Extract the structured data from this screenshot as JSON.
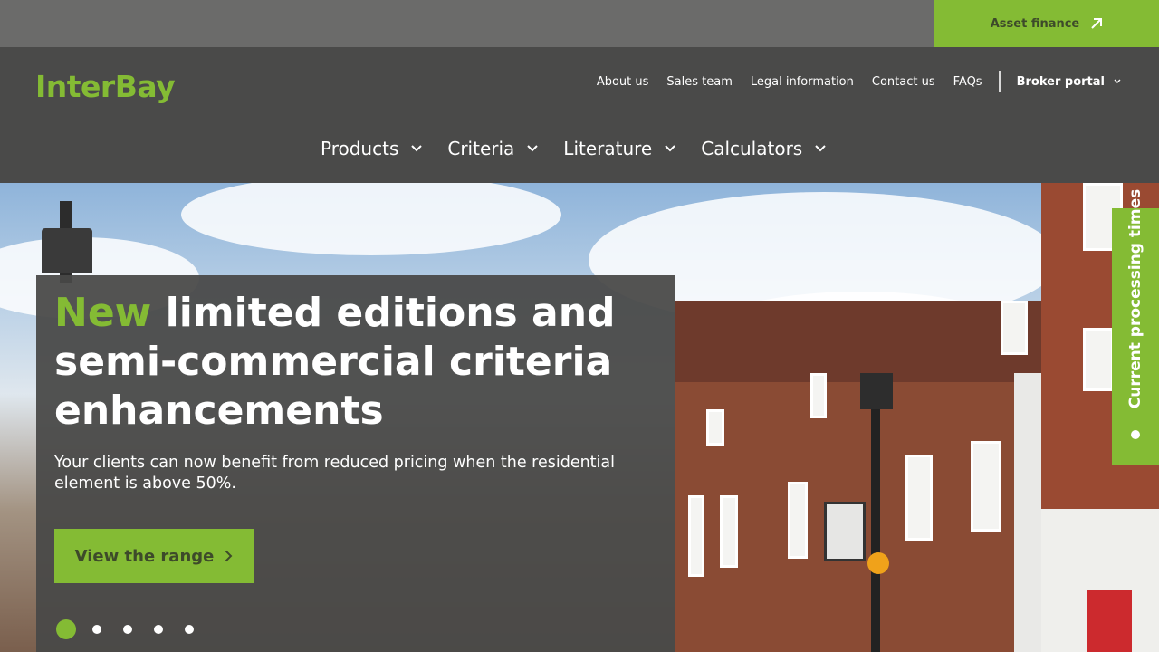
{
  "topbar": {
    "asset_finance_label": "Asset finance"
  },
  "header": {
    "logo_text": "InterBay",
    "utility_links": [
      "About us",
      "Sales team",
      "Legal information",
      "Contact us",
      "FAQs"
    ],
    "broker_portal_label": "Broker portal"
  },
  "main_nav": [
    "Products",
    "Criteria",
    "Literature",
    "Calculators"
  ],
  "hero": {
    "headline_accent": "New",
    "headline_rest": " limited editions and semi-commercial criteria enhancements",
    "subtext": "Your clients can now benefit from reduced pricing when the residential element is above 50%.",
    "cta_label": "View the range",
    "slide_count": 5,
    "active_slide": 1
  },
  "side_tab": {
    "label": "Current processing times"
  },
  "colors": {
    "brand_green": "#84bb34",
    "header_bg": "#4a4a49",
    "topbar_bg": "#6b6b6a"
  }
}
